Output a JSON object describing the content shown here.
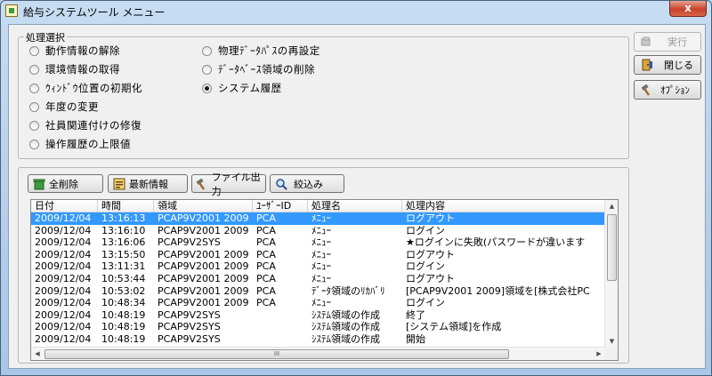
{
  "window": {
    "title": "給与システムツール メニュー",
    "close_label": "x"
  },
  "process_select": {
    "legend": "処理選択",
    "options": [
      {
        "label": "動作情報の解除",
        "selected": false
      },
      {
        "label": "環境情報の取得",
        "selected": false
      },
      {
        "label": "ｳｨﾝﾄﾞｳ位置の初期化",
        "selected": false
      },
      {
        "label": "年度の変更",
        "selected": false
      },
      {
        "label": "社員関連付けの修復",
        "selected": false
      },
      {
        "label": "操作履歴の上限値",
        "selected": false
      },
      {
        "label": "物理ﾃﾞｰﾀﾊﾟｽの再設定",
        "selected": false
      },
      {
        "label": "ﾃﾞｰﾀﾍﾞｰｽ領域の削除",
        "selected": false
      },
      {
        "label": "システム履歴",
        "selected": true
      }
    ]
  },
  "side_buttons": {
    "run": "実行",
    "close": "閉じる",
    "option": "ｵﾌﾟｼｮﾝ"
  },
  "toolbar": {
    "delete_all": "全削除",
    "refresh": "最新情報",
    "file_output": "ファイル出力",
    "filter": "絞込み"
  },
  "log_table": {
    "columns": [
      "日付",
      "時間",
      "領域",
      "ﾕｰｻﾞｰID",
      "処理名",
      "処理内容"
    ],
    "rows": [
      [
        "2009/12/04",
        "13:16:13",
        "PCAP9V2001 2009",
        "PCA",
        "ﾒﾆｭｰ",
        "ログアウト"
      ],
      [
        "2009/12/04",
        "13:16:10",
        "PCAP9V2001 2009",
        "PCA",
        "ﾒﾆｭｰ",
        "ログイン"
      ],
      [
        "2009/12/04",
        "13:16:06",
        "PCAP9V2SYS",
        "PCA",
        "ﾒﾆｭｰ",
        "★ログインに失敗(パスワードが違います"
      ],
      [
        "2009/12/04",
        "13:15:50",
        "PCAP9V2001 2009",
        "PCA",
        "ﾒﾆｭｰ",
        "ログアウト"
      ],
      [
        "2009/12/04",
        "13:11:31",
        "PCAP9V2001 2009",
        "PCA",
        "ﾒﾆｭｰ",
        "ログイン"
      ],
      [
        "2009/12/04",
        "10:53:44",
        "PCAP9V2001 2009",
        "PCA",
        "ﾒﾆｭｰ",
        "ログアウト"
      ],
      [
        "2009/12/04",
        "10:53:02",
        "PCAP9V2001 2009",
        "PCA",
        "ﾃﾞｰﾀ領域のﾘｶﾊﾞﾘ",
        "[PCAP9V2001 2009]領域を[株式会社PC"
      ],
      [
        "2009/12/04",
        "10:48:34",
        "PCAP9V2001 2009",
        "PCA",
        "ﾒﾆｭｰ",
        "ログイン"
      ],
      [
        "2009/12/04",
        "10:48:19",
        "PCAP9V2SYS",
        "",
        "ｼｽﾃﾑ領域の作成",
        "終了"
      ],
      [
        "2009/12/04",
        "10:48:19",
        "PCAP9V2SYS",
        "",
        "ｼｽﾃﾑ領域の作成",
        "[システム領域]を作成"
      ],
      [
        "2009/12/04",
        "10:48:19",
        "PCAP9V2SYS",
        "",
        "ｼｽﾃﾑ領域の作成",
        "開始"
      ]
    ],
    "selected_row": 0
  },
  "scrollbar_grip": "III"
}
